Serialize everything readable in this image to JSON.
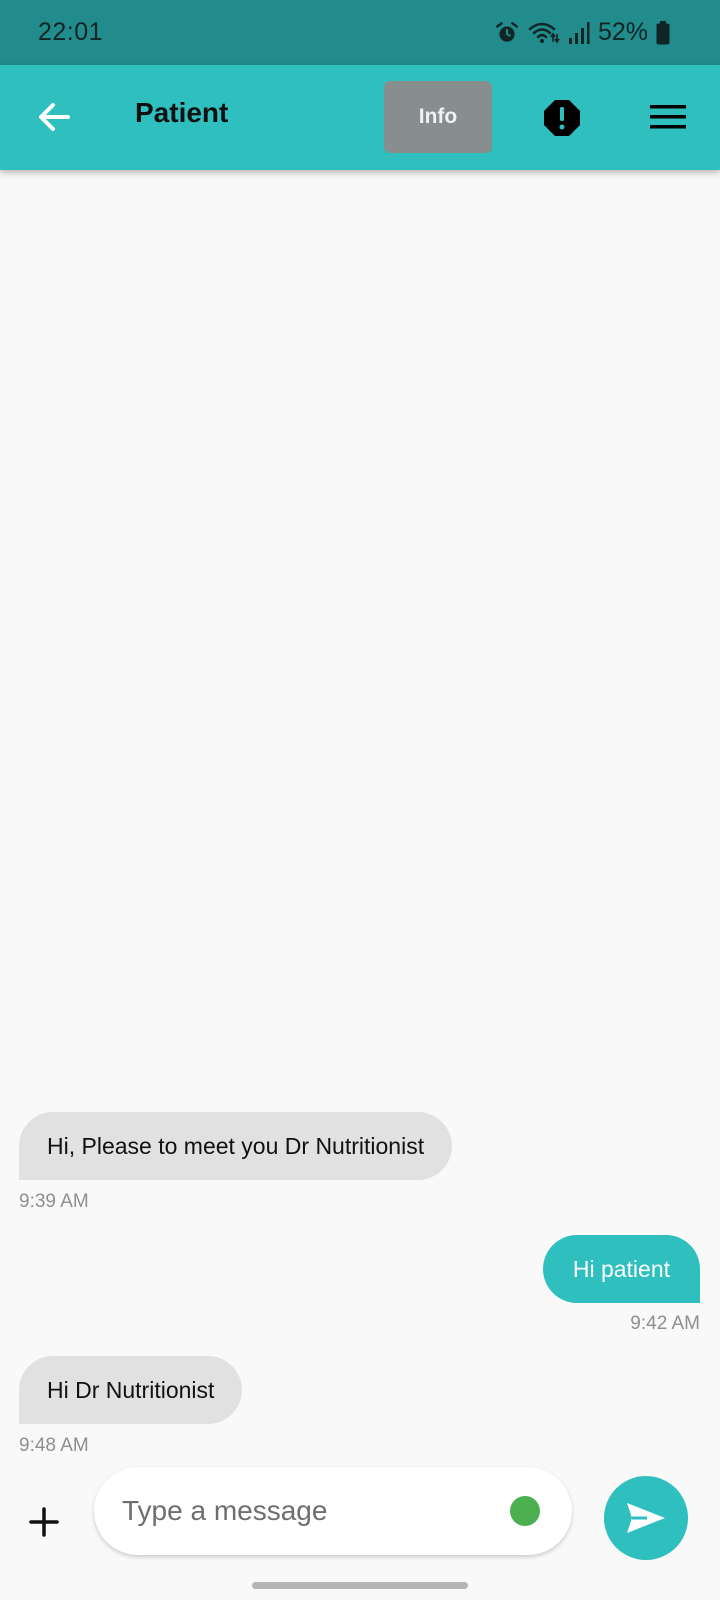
{
  "status_bar": {
    "time": "22:01",
    "battery": "52%",
    "icons": [
      "alarm-icon",
      "wifi-icon",
      "signal-icon",
      "battery-icon"
    ]
  },
  "app_bar": {
    "title": "Patient",
    "info_label": "Info",
    "icons": [
      "back-arrow-icon",
      "alert-octagon-icon",
      "hamburger-menu-icon"
    ],
    "background_color": "#2fbfbf"
  },
  "messages": [
    {
      "direction": "incoming",
      "text": "Hi, Please to meet you Dr Nutritionist",
      "time": "9:39 AM"
    },
    {
      "direction": "outgoing",
      "text": "Hi patient",
      "time": "9:42 AM"
    },
    {
      "direction": "incoming",
      "text": "Hi Dr Nutritionist",
      "time": "9:48 AM"
    }
  ],
  "composer": {
    "placeholder": "Type a message",
    "value": "",
    "icons": [
      "plus-icon",
      "presence-dot-icon",
      "send-icon"
    ]
  },
  "colors": {
    "accent": "#2fbfbf",
    "status_bar": "#228b8b",
    "incoming_bubble": "#e1e1e1",
    "presence": "#4caf50"
  }
}
